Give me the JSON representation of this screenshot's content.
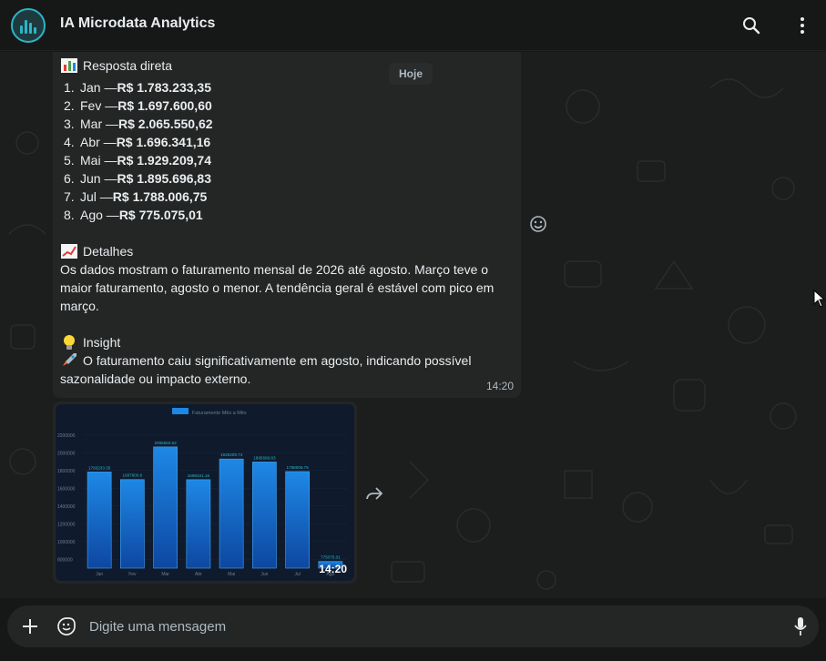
{
  "app": {
    "title": "IA Microdata Analytics"
  },
  "header": {
    "icons": [
      "chart-logo-icon",
      "search-icon",
      "kebab-menu-icon"
    ]
  },
  "chat": {
    "day_chip": "Hoje",
    "message": {
      "section1_title": "Resposta direta",
      "items": [
        {
          "num": "1.",
          "month": "Jan —",
          "value": "R$ 1.783.233,35"
        },
        {
          "num": "2.",
          "month": "Fev —",
          "value": "R$ 1.697.600,60"
        },
        {
          "num": "3.",
          "month": "Mar —",
          "value": "R$ 2.065.550,62"
        },
        {
          "num": "4.",
          "month": "Abr —",
          "value": "R$ 1.696.341,16"
        },
        {
          "num": "5.",
          "month": "Mai —",
          "value": "R$ 1.929.209,74"
        },
        {
          "num": "6.",
          "month": "Jun —",
          "value": "R$ 1.895.696,83"
        },
        {
          "num": "7.",
          "month": "Jul —",
          "value": "R$ 1.788.006,75"
        },
        {
          "num": "8.",
          "month": "Ago —",
          "value": "R$ 775.075,01"
        }
      ],
      "section2_title": "Detalhes",
      "details": "Os dados mostram o faturamento mensal de 2026 até agosto. Março teve o maior faturamento, agosto o menor. A tendência geral é estável com pico em março.",
      "section3_title": "Insight",
      "insight": "O faturamento caiu significativamente em agosto, indicando possível sazonalidade ou impacto externo.",
      "time": "14:20"
    },
    "image_message": {
      "time": "14:20"
    }
  },
  "chart_data": {
    "type": "bar",
    "title": "",
    "legend": "Faturamento Mês a Mês",
    "legend_position": "top",
    "categories": [
      "Jan",
      "Fev",
      "Mar",
      "Abr",
      "Mai",
      "Jun",
      "Jul",
      "Ago"
    ],
    "values": [
      1783233.35,
      1697600.6,
      2065550.62,
      1696341.16,
      1929209.74,
      1895696.83,
      1788006.75,
      775075.01
    ],
    "value_labels": [
      "1783233.35",
      "1697600.6",
      "2065550.62",
      "1696341.16",
      "1929209.74",
      "1895696.83",
      "1788006.75",
      "775075.01"
    ],
    "y_ticks": [
      "800000",
      "1000000",
      "1200000",
      "1400000",
      "1600000",
      "1800000",
      "2000000",
      "2200000"
    ],
    "ylim": [
      700000,
      2300000
    ],
    "bar_color": "#1e88e5",
    "background": "#0f1b2d"
  },
  "composer": {
    "placeholder": "Digite uma mensagem",
    "icons": [
      "plus-icon",
      "sticker-icon",
      "mic-icon"
    ]
  }
}
